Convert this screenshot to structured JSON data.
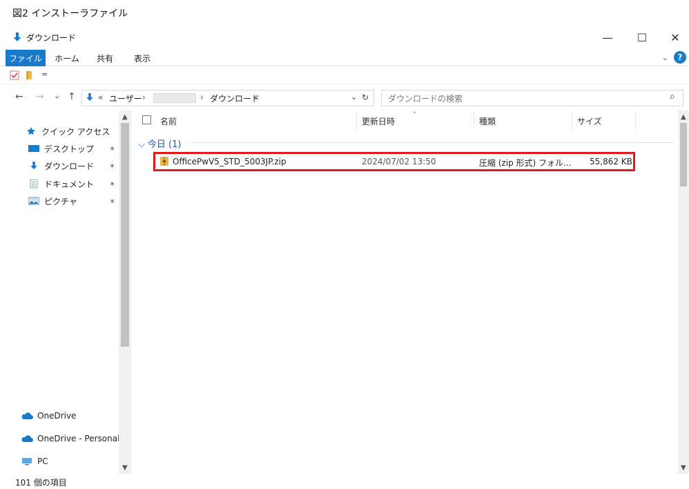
{
  "caption": "図2 インストーラファイル",
  "window": {
    "title": "ダウンロード",
    "minimize": "—",
    "maximize": "☐",
    "close": "✕"
  },
  "ribbon": {
    "tabs": [
      {
        "label": "ファイル",
        "active": true
      },
      {
        "label": "ホーム",
        "active": false
      },
      {
        "label": "共有",
        "active": false
      },
      {
        "label": "表示",
        "active": false
      }
    ],
    "expand_glyph": "⌄",
    "help_glyph": "?"
  },
  "qat": {
    "dropdown_glyph": "="
  },
  "address": {
    "back": "←",
    "forward": "→",
    "recent": "⌄",
    "up": "↑",
    "overflow": "«",
    "crumbs": [
      "ユーザー",
      "ダウンロード"
    ],
    "sep": "›",
    "dropdown": "⌄",
    "refresh": "↻"
  },
  "search": {
    "placeholder": "ダウンロードの検索",
    "icon": "⌕"
  },
  "nav": {
    "quick_access": "クイック アクセス",
    "items": [
      {
        "label": "デスクトップ",
        "icon": "desktop-icon"
      },
      {
        "label": "ダウンロード",
        "icon": "download-icon"
      },
      {
        "label": "ドキュメント",
        "icon": "document-icon"
      },
      {
        "label": "ピクチャ",
        "icon": "pictures-icon"
      }
    ],
    "pin_glyph": "✶",
    "onedrive": "OneDrive",
    "onedrive_personal": "OneDrive - Personal",
    "pc": "PC"
  },
  "columns": {
    "name": "名前",
    "modified": "更新日時",
    "type": "種類",
    "size": "サイズ",
    "sort_glyph": "⌄"
  },
  "group": {
    "chevron": "⌵",
    "label": "今日 (1)"
  },
  "files": [
    {
      "name": "OfficePwV5_STD_5003JP.zip",
      "modified": "2024/07/02 13:50",
      "type": "圧縮 (zip 形式) フォル...",
      "size": "55,862 KB"
    }
  ],
  "status": {
    "count": "101 個の項目"
  },
  "colors": {
    "accent": "#1979ca",
    "highlight": "#e01b1b",
    "folder": "#e8b84a"
  }
}
